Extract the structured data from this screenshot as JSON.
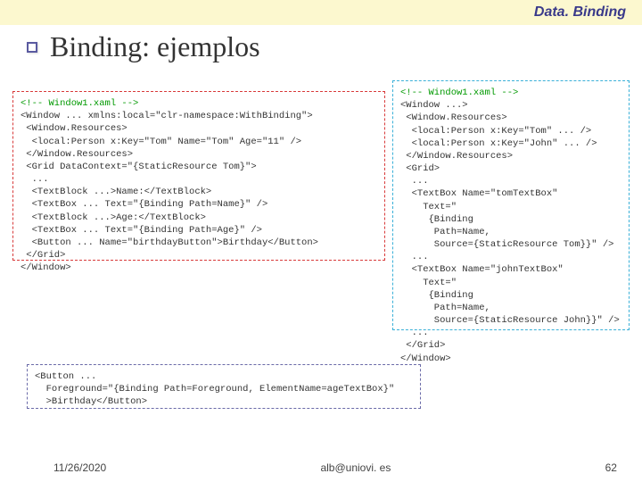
{
  "header": {
    "topic": "Data. Binding"
  },
  "title": "Binding: ejemplos",
  "code": {
    "left": {
      "comment": "<!-- Window1.xaml -->",
      "body": "<Window ... xmlns:local=\"clr-namespace:WithBinding\">\n <Window.Resources>\n  <local:Person x:Key=\"Tom\" Name=\"Tom\" Age=\"11\" />\n </Window.Resources>\n <Grid DataContext=\"{StaticResource Tom}\">\n  ...\n  <TextBlock ...>Name:</TextBlock>\n  <TextBox ... Text=\"{Binding Path=Name}\" />\n  <TextBlock ...>Age:</TextBlock>\n  <TextBox ... Text=\"{Binding Path=Age}\" />\n  <Button ... Name=\"birthdayButton\">Birthday</Button>\n </Grid>\n</Window>"
    },
    "right": {
      "comment": "<!-- Window1.xaml -->",
      "body": "<Window ...>\n <Window.Resources>\n  <local:Person x:Key=\"Tom\" ... />\n  <local:Person x:Key=\"John\" ... />\n </Window.Resources>\n <Grid>\n  ...\n  <TextBox Name=\"tomTextBox\"\n    Text=\"\n     {Binding\n      Path=Name,\n      Source={StaticResource Tom}}\" />\n  ...\n  <TextBox Name=\"johnTextBox\"\n    Text=\"\n     {Binding\n      Path=Name,\n      Source={StaticResource John}}\" />\n  ...\n </Grid>\n</Window>"
    },
    "bottom": {
      "body": "<Button ...\n  Foreground=\"{Binding Path=Foreground, ElementName=ageTextBox}\"\n  >Birthday</Button>"
    }
  },
  "footer": {
    "date": "11/26/2020",
    "email": "alb@uniovi. es",
    "page": "62"
  }
}
